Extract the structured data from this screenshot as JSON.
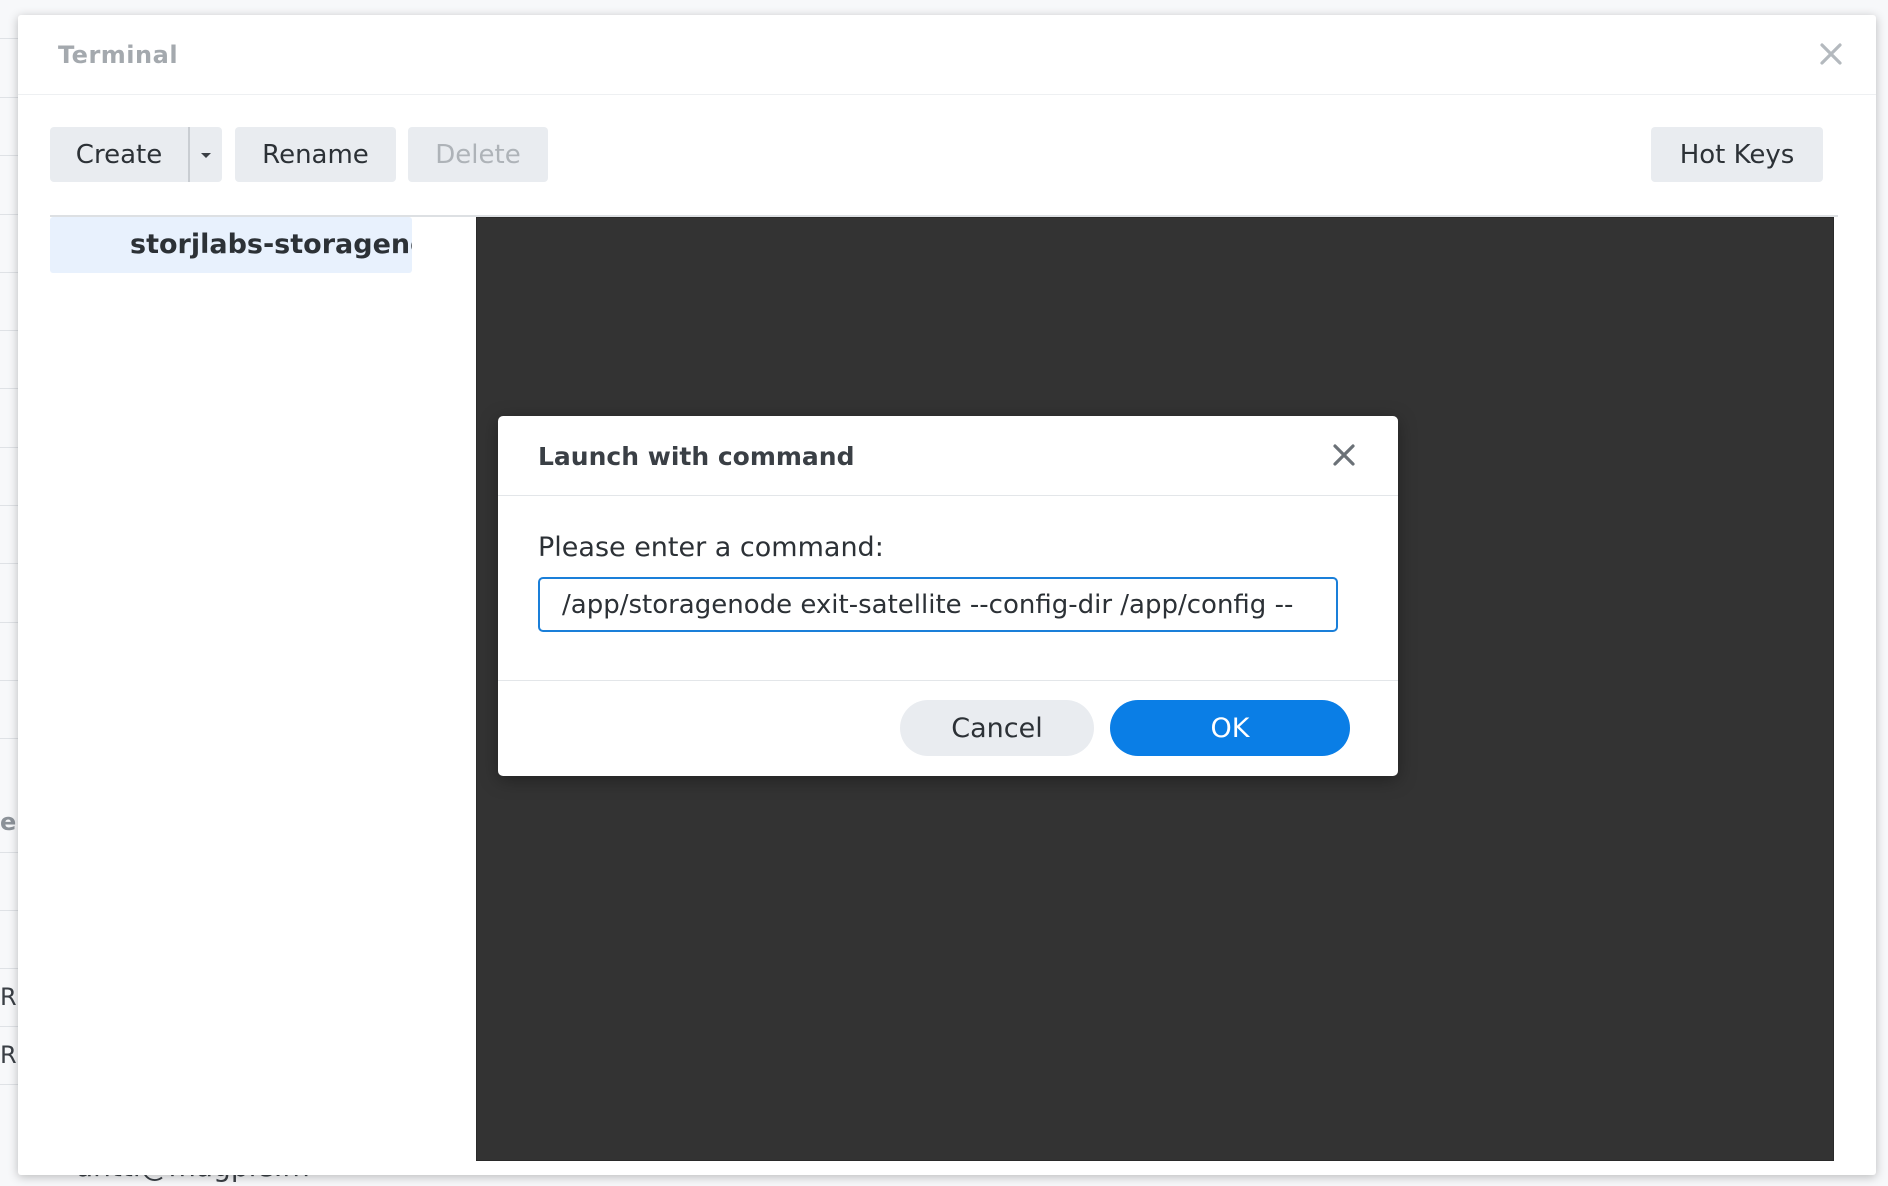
{
  "background": {
    "fragments": [
      "e",
      "R",
      "R"
    ],
    "bottom_text": "antti@magpie.m"
  },
  "window": {
    "title": "Terminal"
  },
  "toolbar": {
    "create_label": "Create",
    "rename_label": "Rename",
    "delete_label": "Delete",
    "hotkeys_label": "Hot Keys"
  },
  "sessions": {
    "items": [
      {
        "label": "storjlabs-storagenode"
      }
    ]
  },
  "dialog": {
    "title": "Launch with command",
    "prompt": "Please enter a command:",
    "command_value": "/app/storagenode exit-satellite --config-dir /app/config --",
    "cancel_label": "Cancel",
    "ok_label": "OK"
  },
  "colors": {
    "accent": "#0a7ee6",
    "console_bg": "#333333",
    "selected_item_bg": "#e8f1fd"
  }
}
